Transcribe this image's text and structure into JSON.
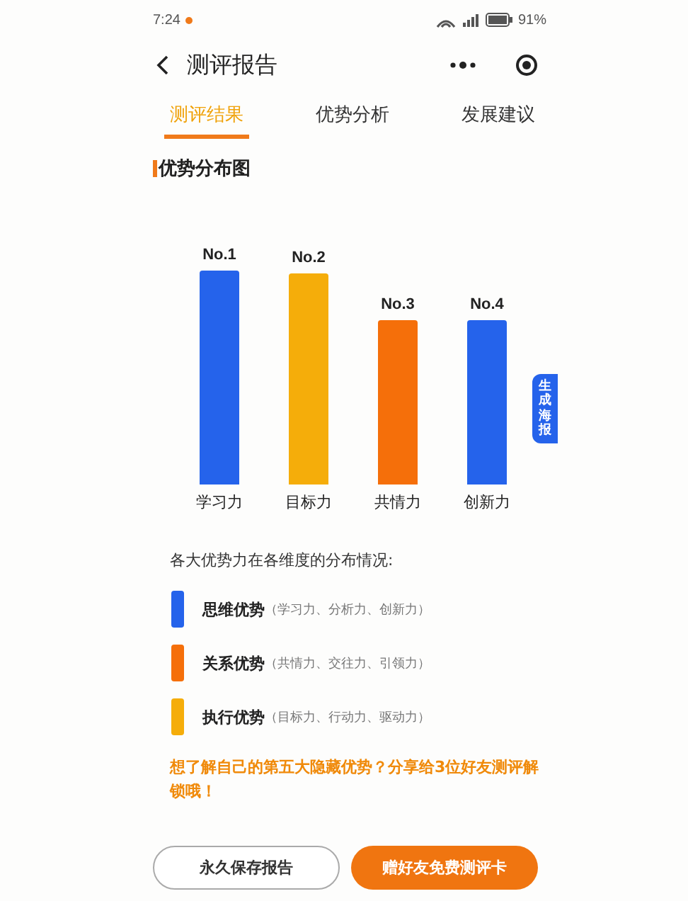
{
  "status_bar": {
    "time": "7:24",
    "battery": "91%"
  },
  "header": {
    "title": "测评报告"
  },
  "tabs": [
    {
      "label": "测评结果",
      "selected": true
    },
    {
      "label": "优势分析",
      "selected": false
    },
    {
      "label": "发展建议",
      "selected": false
    }
  ],
  "section_title": "优势分布图",
  "bars": [
    {
      "rank": "No.1",
      "label": "学习力",
      "color": "#2563eb"
    },
    {
      "rank": "No.2",
      "label": "目标力",
      "color": "#f5ad0a"
    },
    {
      "rank": "No.3",
      "label": "共情力",
      "color": "#f56f0a"
    },
    {
      "rank": "No.4",
      "label": "创新力",
      "color": "#2563eb"
    }
  ],
  "poster_button": "生成海报",
  "legend_intro": "各大优势力在各维度的分布情况:",
  "legend": [
    {
      "name": "思维优势",
      "detail": "（学习力、分析力、创新力）",
      "color": "#2563eb"
    },
    {
      "name": "关系优势",
      "detail": "（共情力、交往力、引领力）",
      "color": "#f56f0a"
    },
    {
      "name": "执行优势",
      "detail": "（目标力、行动力、驱动力）",
      "color": "#f5ad0a"
    }
  ],
  "promo": "想了解自己的第五大隐藏优势？分享给3位好友测评解锁哦！",
  "buttons": [
    {
      "label": "永久保存报告",
      "kind": "outline"
    },
    {
      "label": "赠好友免费测评卡",
      "kind": "filled"
    }
  ]
}
